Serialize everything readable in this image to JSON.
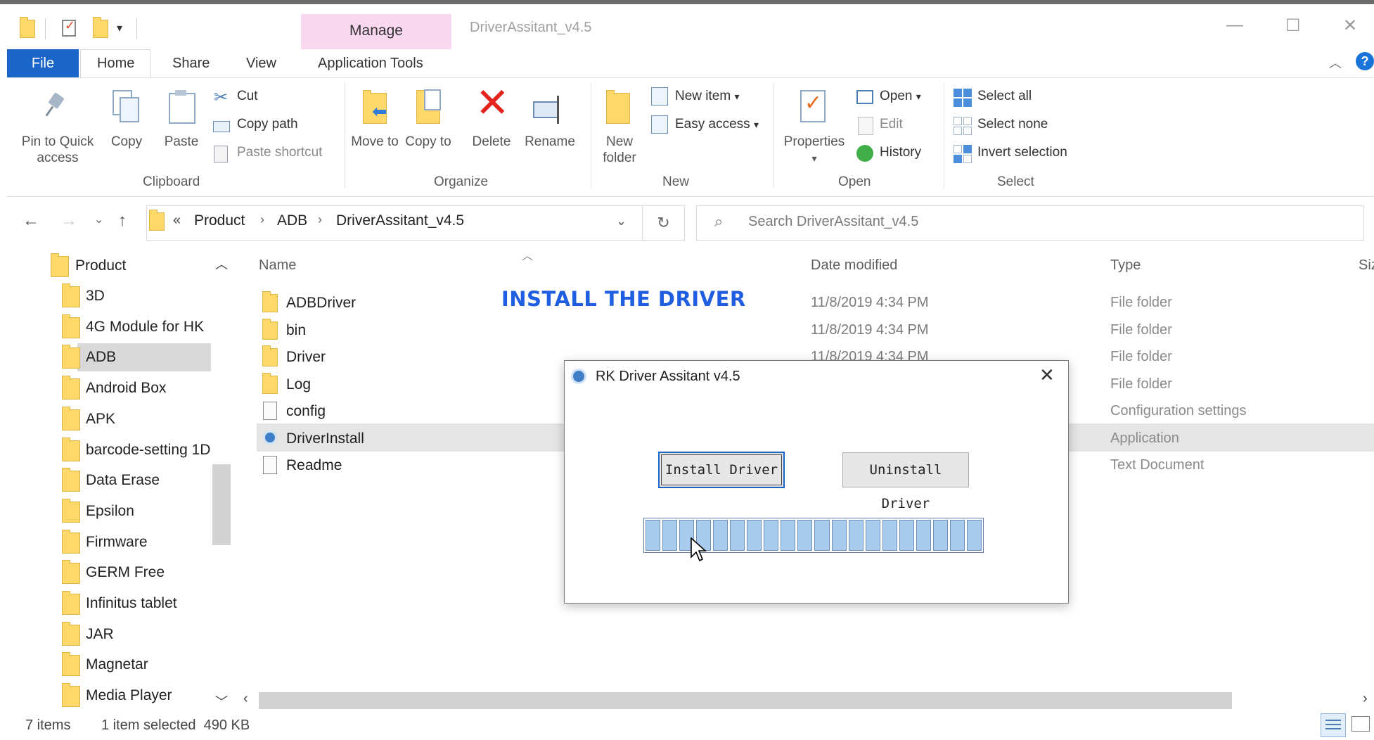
{
  "titlebar": {
    "manage_tab": "Manage",
    "window_title": "DriverAssitant_v4.5",
    "minimize": "—",
    "maximize": "☐",
    "close": "✕"
  },
  "ribbon_tabs": {
    "file": "File",
    "home": "Home",
    "share": "Share",
    "view": "View",
    "app_tools": "Application Tools"
  },
  "ribbon": {
    "clipboard": {
      "pin": "Pin to Quick access",
      "copy": "Copy",
      "paste": "Paste",
      "cut": "Cut",
      "copy_path": "Copy path",
      "paste_shortcut": "Paste shortcut",
      "label": "Clipboard"
    },
    "organize": {
      "move_to": "Move to",
      "copy_to": "Copy to",
      "delete": "Delete",
      "rename": "Rename",
      "label": "Organize"
    },
    "new": {
      "new_folder": "New folder",
      "new_item": "New item",
      "easy_access": "Easy access",
      "label": "New"
    },
    "open": {
      "properties": "Properties",
      "open": "Open",
      "edit": "Edit",
      "history": "History",
      "label": "Open"
    },
    "select": {
      "select_all": "Select all",
      "select_none": "Select none",
      "invert": "Invert selection",
      "label": "Select"
    }
  },
  "address": {
    "chevrons": "«",
    "crumbs": [
      "Product",
      "ADB",
      "DriverAssitant_v4.5"
    ],
    "search_placeholder": "Search DriverAssitant_v4.5"
  },
  "nav": {
    "root": "Product",
    "items": [
      "3D",
      "4G Module for HK",
      "ADB",
      "Android Box",
      "APK",
      "barcode-setting 1D",
      "Data Erase",
      "Epsilon",
      "Firmware",
      "GERM Free",
      "Infinitus tablet",
      "JAR",
      "Magnetar",
      "Media Player"
    ],
    "selected": "ADB"
  },
  "columns": {
    "name": "Name",
    "date": "Date modified",
    "type": "Type",
    "size": "Siz"
  },
  "overlay_caption": "INSTALL THE DRIVER",
  "files": [
    {
      "name": "ADBDriver",
      "date": "11/8/2019 4:34 PM",
      "type": "File folder",
      "icon": "folder-icon"
    },
    {
      "name": "bin",
      "date": "11/8/2019 4:34 PM",
      "type": "File folder",
      "icon": "folder-icon"
    },
    {
      "name": "Driver",
      "date": "11/8/2019 4:34 PM",
      "type": "File folder",
      "icon": "folder-icon"
    },
    {
      "name": "Log",
      "date": "",
      "type": "File folder",
      "icon": "folder-icon"
    },
    {
      "name": "config",
      "date": "",
      "type": "Configuration settings",
      "icon": "settings-file-icon"
    },
    {
      "name": "DriverInstall",
      "date": "",
      "type": "Application",
      "icon": "app-icon"
    },
    {
      "name": "Readme",
      "date": "",
      "type": "Text Document",
      "icon": "text-file-icon"
    }
  ],
  "dialog": {
    "title": "RK Driver Assitant v4.5",
    "install": "Install Driver",
    "uninstall": "Uninstall Driver",
    "progress_segments": 20
  },
  "status": {
    "items": "7 items",
    "selected": "1 item selected  490 KB"
  }
}
